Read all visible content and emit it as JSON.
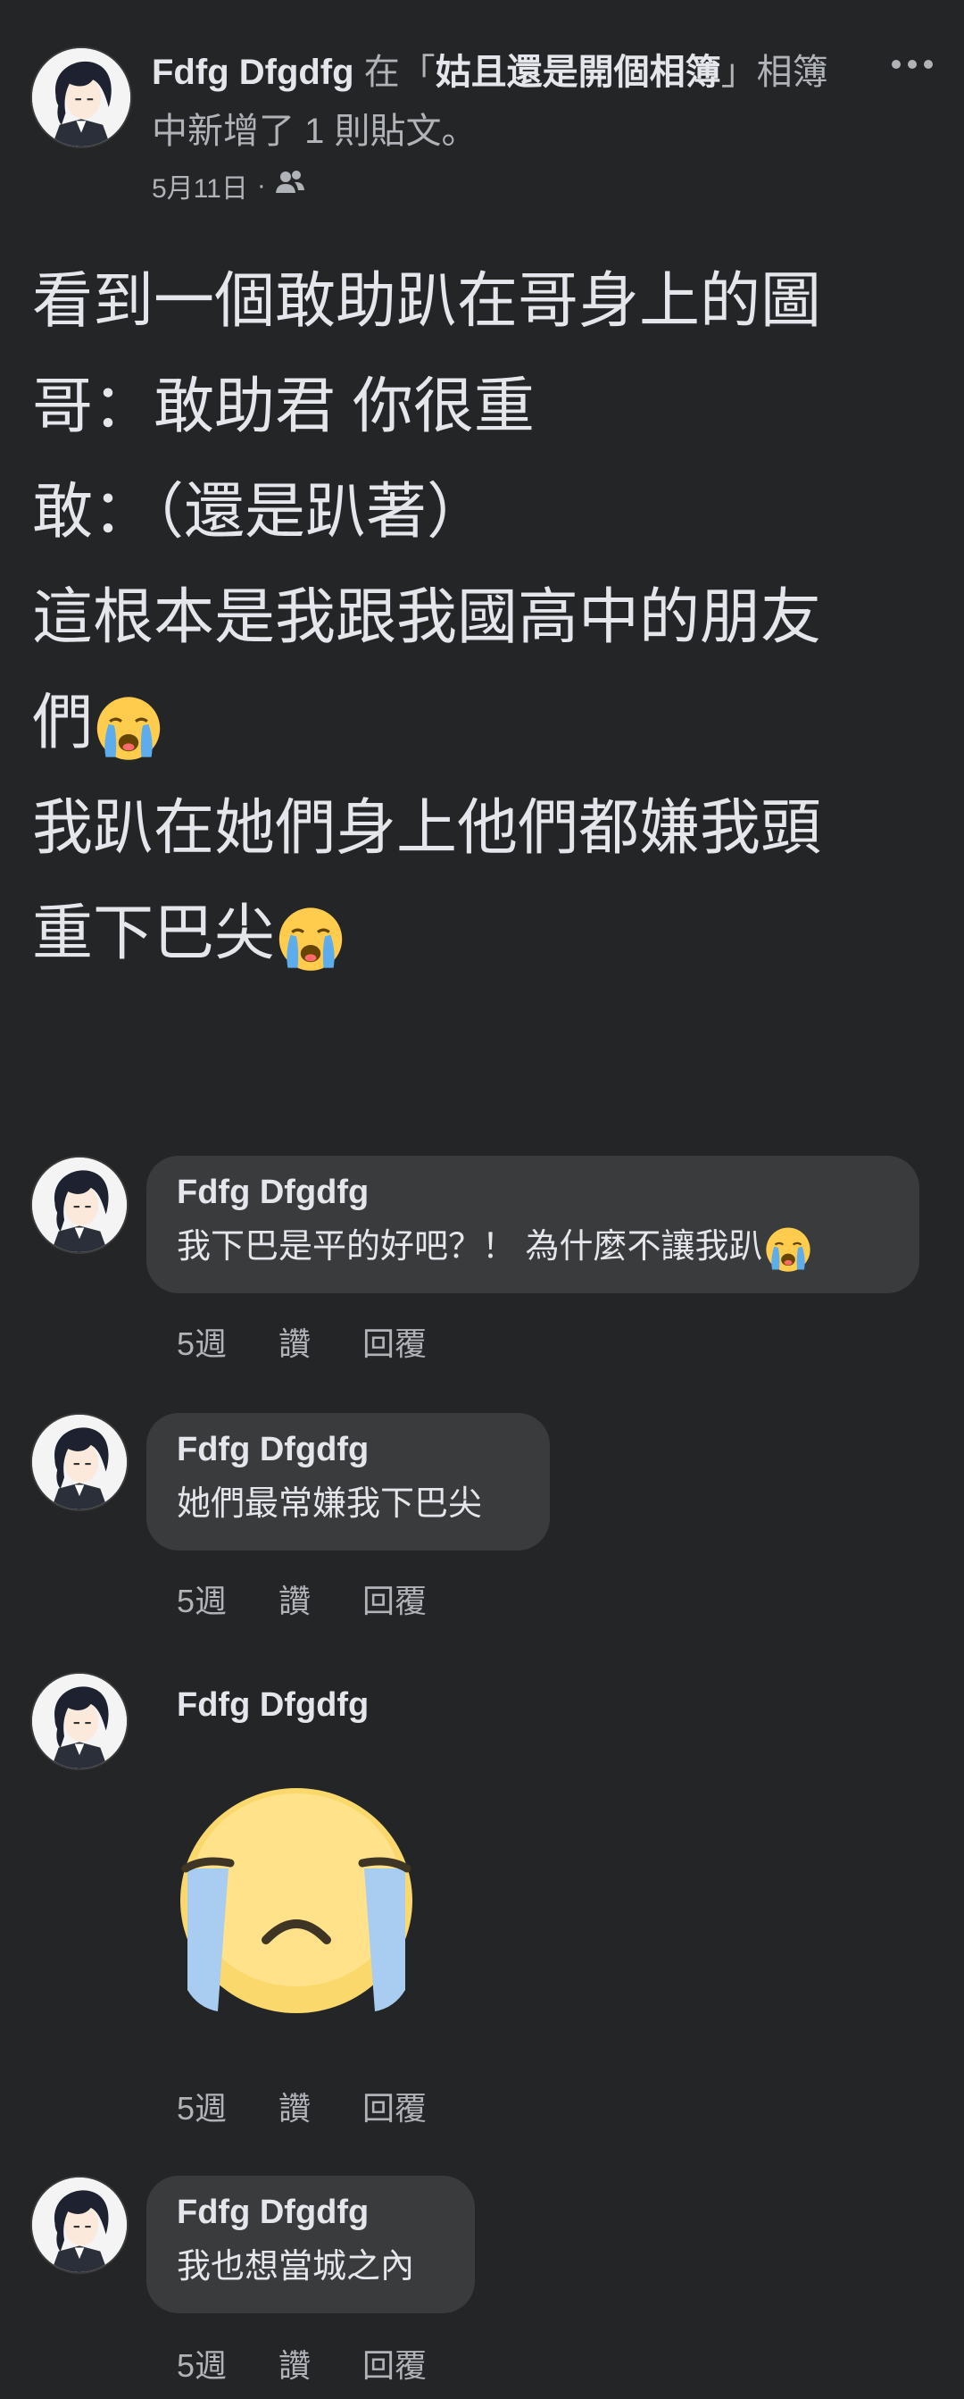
{
  "post": {
    "author": "Fdfg Dfgdfg",
    "action_prefix": "在「",
    "album": "姑且還是開個相簿",
    "action_suffix": "」相簿中新增了 1 則貼文。",
    "date": "5月11日",
    "dot": "·",
    "audience_icon": "friends-icon",
    "more_icon": "more-options-icon",
    "lines": [
      "看到一個敢助趴在哥身上的圖",
      "哥：敢助君 你很重",
      "敢：（還是趴著）",
      "這根本是我跟我國高中的朋友",
      "們",
      "我趴在她們身上他們都嫌我頭",
      "重下巴尖"
    ]
  },
  "comments": [
    {
      "name": "Fdfg Dfgdfg",
      "text": "我下巴是平的好吧？！ 為什麼不讓我趴",
      "time": "5週",
      "like": "讚",
      "reply": "回覆"
    },
    {
      "name": "Fdfg Dfgdfg",
      "text": "她們最常嫌我下巴尖",
      "time": "5週",
      "like": "讚",
      "reply": "回覆"
    },
    {
      "name": "Fdfg Dfgdfg",
      "sticker": "crying-face-sticker",
      "time": "5週",
      "like": "讚",
      "reply": "回覆"
    },
    {
      "name": "Fdfg Dfgdfg",
      "text": "我也想當城之內",
      "time": "5週",
      "like": "讚",
      "reply": "回覆"
    }
  ],
  "colors": {
    "background": "#242526",
    "bubble": "#3a3b3c",
    "text": "#e4e6eb",
    "secondary": "#b0b3b8"
  }
}
